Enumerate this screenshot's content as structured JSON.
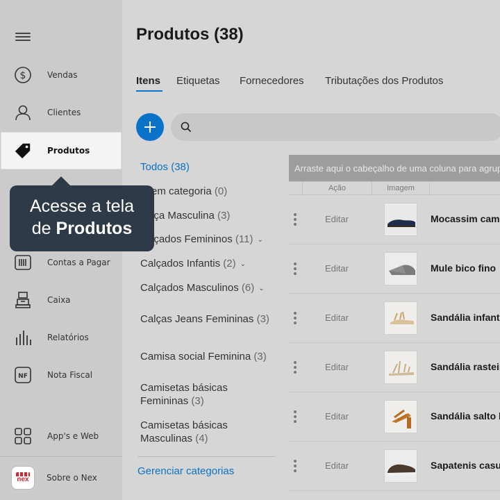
{
  "sidebar": {
    "items": [
      {
        "label": "Vendas",
        "icon": "dollar-circle-icon"
      },
      {
        "label": "Clientes",
        "icon": "user-icon"
      },
      {
        "label": "Produtos",
        "icon": "tag-icon"
      },
      {
        "label": "Contas a Pagar",
        "icon": "barcode-icon"
      },
      {
        "label": "Caixa",
        "icon": "cash-register-icon"
      },
      {
        "label": "Relatórios",
        "icon": "bar-chart-icon"
      },
      {
        "label": "Nota Fiscal",
        "icon": "nf-icon"
      },
      {
        "label": "App's e Web",
        "icon": "apps-grid-icon"
      },
      {
        "label": "Sobre o Nex",
        "icon": "nex-logo"
      }
    ],
    "logo_text": "nex"
  },
  "tooltip": {
    "line1": "Acesse a tela",
    "line2_prefix": "de ",
    "line2_bold": "Produtos"
  },
  "page": {
    "title": "Produtos (38)"
  },
  "tabs": [
    {
      "label": "Itens",
      "active": true
    },
    {
      "label": "Etiquetas"
    },
    {
      "label": "Fornecedores"
    },
    {
      "label": "Tributações dos Produtos"
    }
  ],
  "search": {
    "placeholder": ""
  },
  "categories": [
    {
      "name": "Todos",
      "count": "(38)",
      "active": true
    },
    {
      "name": "Sem categoria",
      "visible": "em categoria",
      "count": "(0)"
    },
    {
      "name": "Calça Masculina",
      "visible": "lça Masculina",
      "count": "(3)"
    },
    {
      "name": "Calçados Femininos",
      "visible": "lçados Femininos",
      "count": "(11)",
      "expandable": true
    },
    {
      "name": "Calçados Infantis",
      "count": "(2)",
      "expandable": true
    },
    {
      "name": "Calçados Masculinos",
      "count": "(6)",
      "expandable": true
    },
    {
      "name": "Calças Jeans Femininas",
      "count": "(3)"
    },
    {
      "name": "Camisa social Feminina",
      "count": "(3)"
    },
    {
      "name": "Camisetas básicas Femininas",
      "count": "(3)"
    },
    {
      "name": "Camisetas básicas Masculinas",
      "count": "(4)"
    }
  ],
  "manage_categories": "Gerenciar categorias",
  "grid": {
    "group_hint": "Arraste aqui o cabeçalho de uma coluna para agrupar",
    "columns": [
      "Ação",
      "Imagem"
    ],
    "edit_label": "Editar",
    "rows": [
      {
        "name": "Mocassim camurça",
        "image": "shoe-navy-loafer"
      },
      {
        "name": "Mule bico fino",
        "image": "shoe-gray-mule"
      },
      {
        "name": "Sandália infantil",
        "image": "shoe-gold-sandal"
      },
      {
        "name": "Sandália rasteira",
        "image": "shoe-beige-sandal"
      },
      {
        "name": "Sandália salto bloco",
        "image": "shoe-caramel-heel"
      },
      {
        "name": "Sapatenis casual",
        "image": "shoe-brown-sneaker"
      }
    ]
  },
  "colors": {
    "accent": "#0a72c8",
    "tooltip_bg": "#2f3a48",
    "brand_red": "#d8242f"
  }
}
